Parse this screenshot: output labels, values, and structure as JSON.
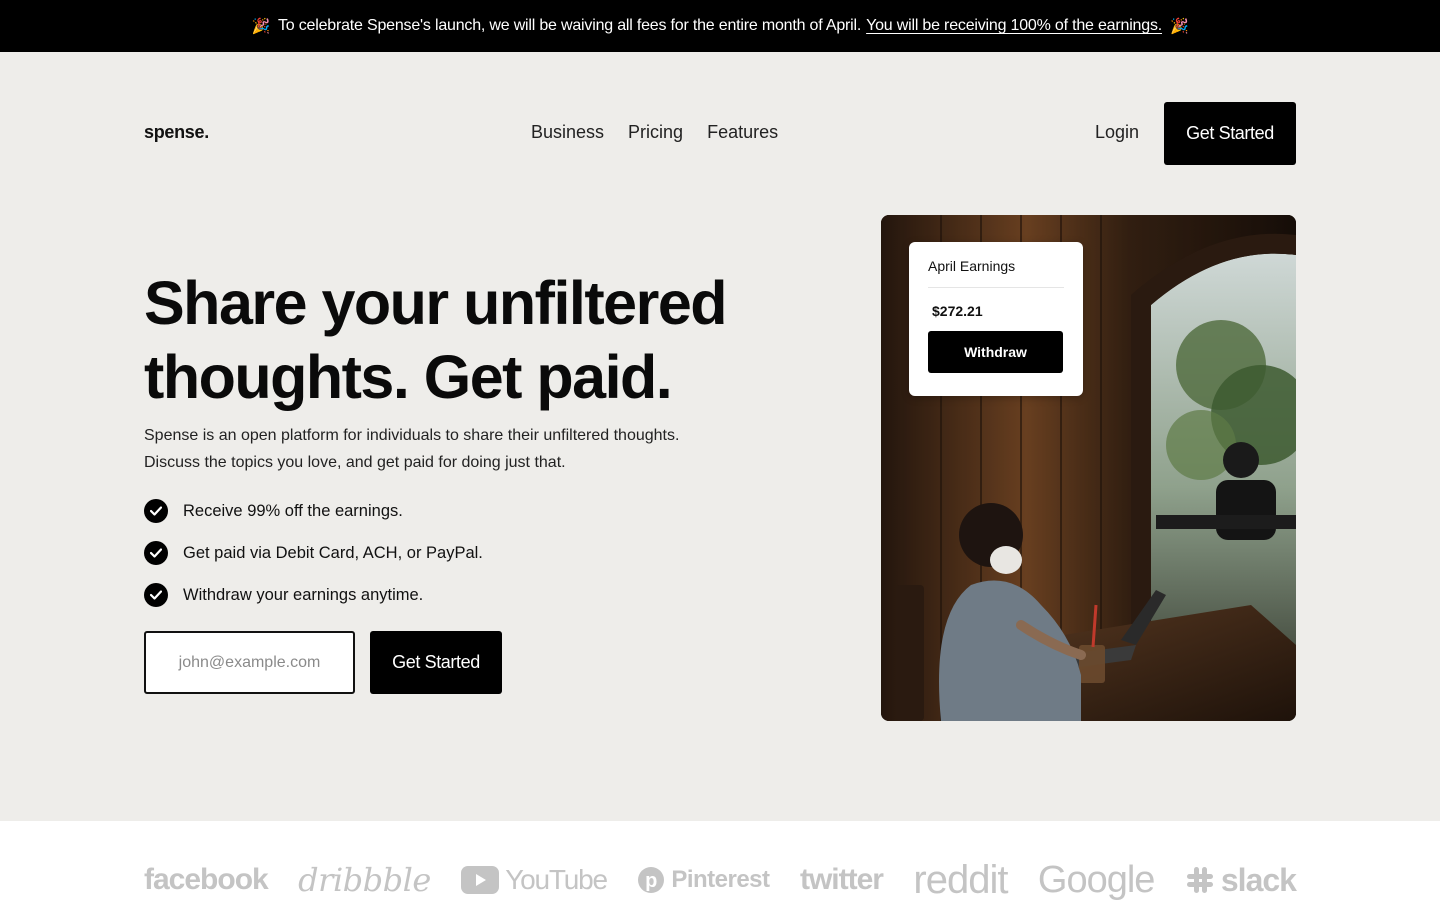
{
  "announcement": {
    "emoji_left": "🎉",
    "text": "To celebrate Spense's launch, we will be waiving all fees for the entire month of April.",
    "link": "You will be receiving 100% of the earnings.",
    "emoji_right": "🎉"
  },
  "nav": {
    "logo": "spense.",
    "links": [
      "Business",
      "Pricing",
      "Features"
    ],
    "login": "Login",
    "cta": "Get Started"
  },
  "hero": {
    "title_line1": "Share your unfiltered",
    "title_line2": "thoughts. Get paid.",
    "desc_line1": "Spense is an open platform for individuals to share their unfiltered thoughts.",
    "desc_line2": "Discuss the topics you love, and get paid for doing just that.",
    "features": [
      "Receive 99% off the earnings.",
      "Get paid via Debit Card, ACH, or PayPal.",
      "Withdraw your earnings anytime."
    ],
    "email_placeholder": "john@example.com",
    "cta": "Get Started"
  },
  "earnings_card": {
    "title": "April Earnings",
    "amount": "$272.21",
    "button": "Withdraw"
  },
  "brands": [
    "facebook",
    "dribbble",
    "YouTube",
    "Pinterest",
    "twitter",
    "reddit",
    "Google",
    "slack"
  ],
  "colors": {
    "background": "#eeedea",
    "primary": "#000000",
    "brand_logo_gray": "#c4c4c4"
  }
}
